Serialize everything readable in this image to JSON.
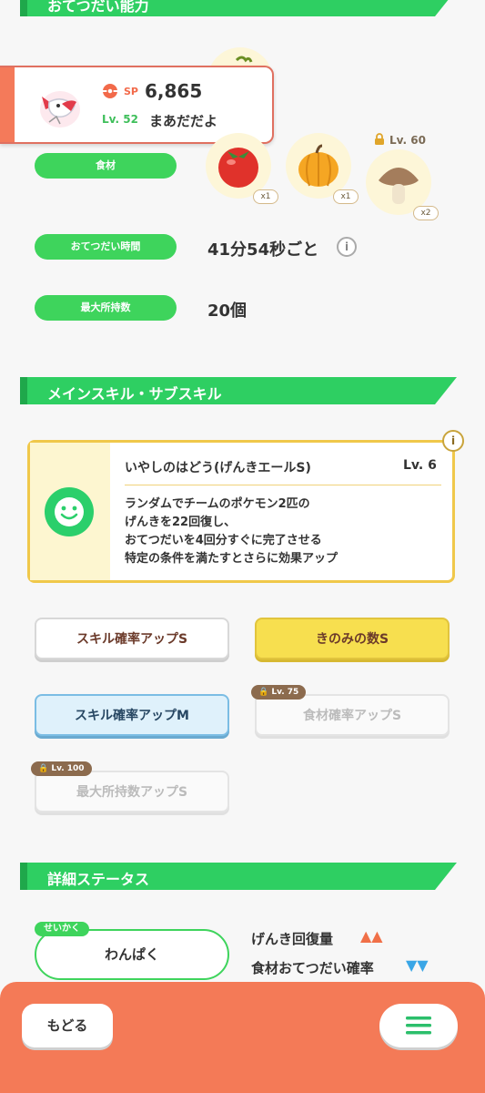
{
  "section_helping": {
    "title": "おてつだい能力"
  },
  "pokemon": {
    "sp_label": "SP",
    "sp_value": "6,865",
    "level": "Lv. 52",
    "nickname": "まあだだよ"
  },
  "ingredients": {
    "label": "食材",
    "items": [
      {
        "name": "tomato",
        "qty": "x1"
      },
      {
        "name": "pumpkin",
        "qty": "x1"
      },
      {
        "name": "mushroom",
        "qty": "x2",
        "lock_level": "Lv. 60"
      }
    ]
  },
  "help_time": {
    "label": "おてつだい時間",
    "value": "41分54秒ごと"
  },
  "max_carry": {
    "label": "最大所持数",
    "value": "20個"
  },
  "section_skills": {
    "title": "メインスキル・サブスキル"
  },
  "main_skill": {
    "name": "いやしのはどう(げんきエールS)",
    "level": "Lv. 6",
    "description_lines": [
      "ランダムでチームのポケモン2匹の",
      "げんきを22回復し、",
      "おてつだいを4回分すぐに完了させる",
      "特定の条件を満たすとさらに効果アップ"
    ]
  },
  "sub_skills": [
    {
      "label": "スキル確率アップS",
      "style": "white"
    },
    {
      "label": "きのみの数S",
      "style": "gold"
    },
    {
      "label": "スキル確率アップM",
      "style": "blue"
    },
    {
      "label": "食材確率アップS",
      "style": "locked",
      "lock_level": "Lv. 75"
    },
    {
      "label": "最大所持数アップS",
      "style": "locked",
      "lock_level": "Lv. 100"
    }
  ],
  "section_status": {
    "title": "詳細ステータス"
  },
  "nature": {
    "tag": "せいかく",
    "value": "わんぱく"
  },
  "nature_effects": [
    {
      "label": "げんき回復量",
      "marks": "▲▲",
      "color": "#f07048"
    },
    {
      "label": "食材おてつだい確率",
      "marks": "▼▼",
      "color": "#3aa6e6"
    }
  ],
  "nav": {
    "back_label": "もどる"
  }
}
